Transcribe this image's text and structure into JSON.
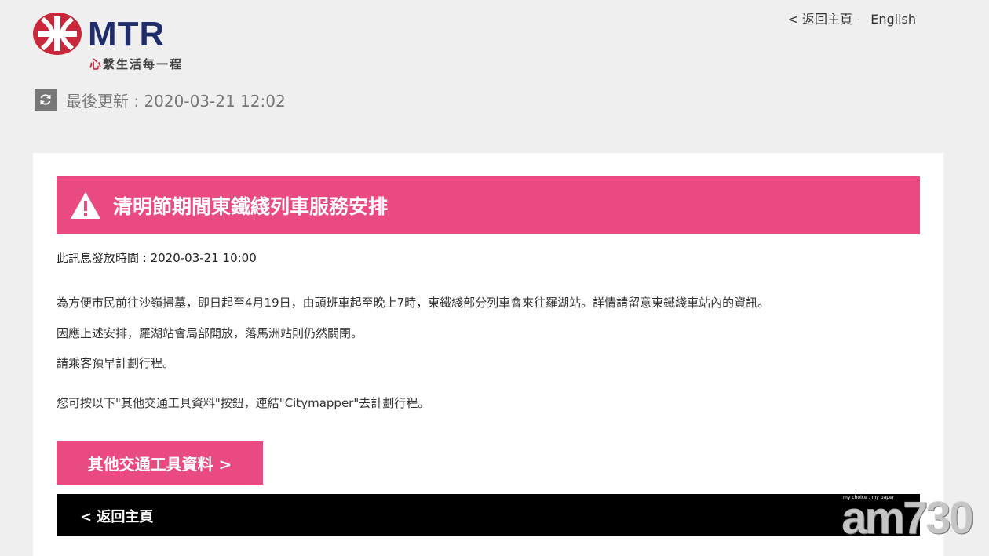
{
  "header": {
    "brand": "MTR",
    "tagline_first": "心",
    "tagline_rest": "繫生活每一程",
    "nav_home": "< 返回主頁",
    "nav_separator": "·",
    "nav_language": "English"
  },
  "update": {
    "label": "最後更新 : 2020-03-21 12:02",
    "icon": "refresh-icon"
  },
  "notice": {
    "title": "清明節期間東鐵綫列車服務安排",
    "icon": "warning-icon",
    "issued": "此訊息發放時間 : 2020-03-21 10:00",
    "paragraphs": [
      "為方便市民前往沙嶺掃墓，即日起至4月19日，由頭班車起至晚上7時，東鐵綫部分列車會來往羅湖站。詳情請留意東鐵綫車站內的資訊。",
      "因應上述安排，羅湖站會局部開放，落馬洲站則仍然關閉。",
      "請乘客預早計劃行程。",
      "您可按以下\"其他交通工具資料\"按鈕，連結\"Citymapper\"去計劃行程。"
    ],
    "other_transport_button": "其他交通工具資料 >",
    "back_link": "< 返回主頁"
  },
  "watermark": {
    "text": "am730",
    "small": "my choice . my paper"
  },
  "colors": {
    "accent_pink": "#ea4a82",
    "mtr_red": "#c8283a",
    "mtr_navy": "#1f2d6b",
    "page_bg": "#efefef"
  }
}
